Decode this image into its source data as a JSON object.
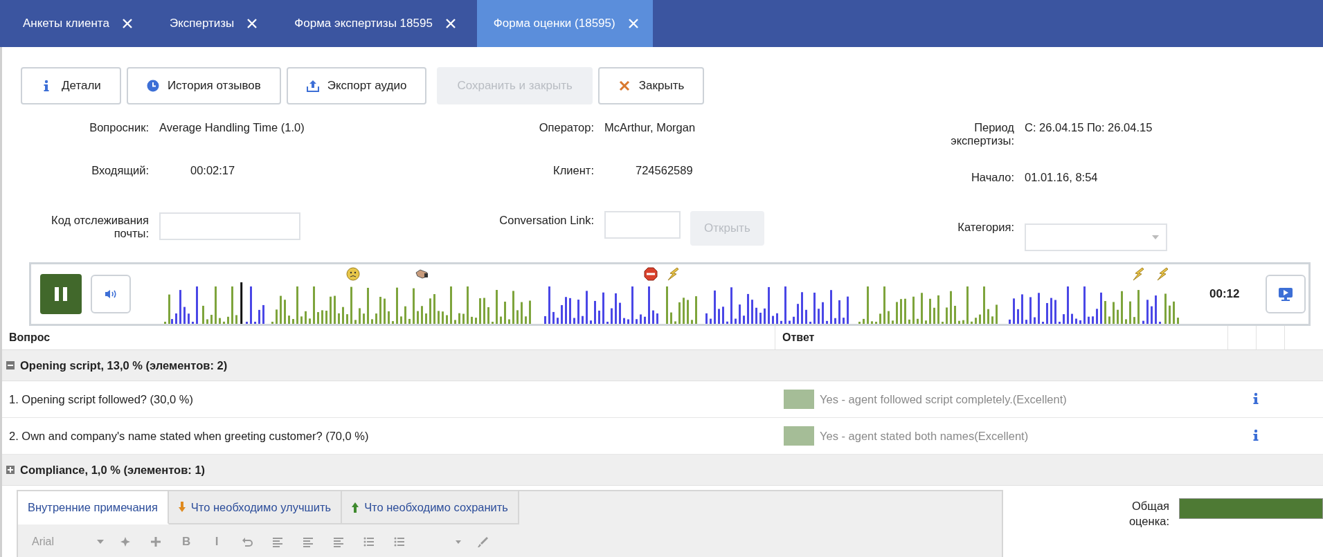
{
  "tabs": [
    {
      "label": "Анкеты клиента",
      "selected": false
    },
    {
      "label": "Экспертизы",
      "selected": false
    },
    {
      "label": "Форма экспертизы 18595",
      "selected": false
    },
    {
      "label": "Форма оценки (18595)",
      "selected": true
    }
  ],
  "toolbar": [
    {
      "kind": "info",
      "label": "Детали",
      "disabled": false
    },
    {
      "kind": "history",
      "label": "История отзывов",
      "disabled": false
    },
    {
      "kind": "export",
      "label": "Экспорт аудио",
      "disabled": false
    },
    {
      "kind": "plain",
      "label": "Сохранить и закрыть",
      "disabled": true
    },
    {
      "kind": "close",
      "label": "Закрыть",
      "disabled": false
    }
  ],
  "details": {
    "questionnaire_label": "Вопросник:",
    "questionnaire": "Average Handling Time (1.0)",
    "operator_label": "Оператор:",
    "operator": "McArthur, Morgan",
    "period_label": "Период экспертизы:",
    "period": "С: 26.04.15 По: 26.04.15",
    "incoming_label": "Входящий:",
    "incoming": "00:02:17",
    "client_label": "Клиент:",
    "client": "724562589",
    "start_label": "Начало:",
    "start": "01.01.16, 8:54",
    "tracking_label": "Код отслеживания почты:",
    "link_label": "Conversation Link:",
    "open_button": {
      "label": "Открыть",
      "disabled": true
    },
    "category_label": "Категория:"
  },
  "player": {
    "playing": true,
    "level": 0.076,
    "time": "00:12",
    "markers": [
      {
        "kind": "sad"
      },
      {
        "kind": "handshake"
      },
      {
        "kind": "stop"
      },
      {
        "kind": "bolt"
      },
      {
        "kind": "bolt"
      },
      {
        "kind": "bolt"
      }
    ]
  },
  "table": {
    "columns": [
      "Вопрос",
      "Ответ"
    ],
    "groups": [
      {
        "title": "Opening script, 13,0 % (элементов: 2)",
        "expanded": true,
        "items": [
          {
            "question": "1. Opening script followed? (30,0 %)",
            "answer": "Yes - agent followed script completely.(Excellent)",
            "color": "#a5bd97"
          },
          {
            "question": "2. Own and company's name stated when greeting customer? (70,0 %)",
            "answer": "Yes - agent stated both names(Excellent)",
            "color": "#a5bd97"
          }
        ]
      },
      {
        "title": "Compliance, 1,0 % (элементов: 1)",
        "expanded": false
      }
    ]
  },
  "notes": {
    "tabs": [
      {
        "kind": "plain",
        "label": "Внутренние примечания",
        "selected": true
      },
      {
        "kind": "down",
        "label": "Что необходимо улучшить",
        "selected": false
      },
      {
        "kind": "up",
        "label": "Что необходимо сохранить",
        "selected": false
      }
    ],
    "editor": {
      "disabled": true,
      "font": "Arial",
      "tools": [
        {
          "kind": "sparkle"
        },
        {
          "kind": "cross"
        },
        {
          "kind": "text",
          "label": "B"
        },
        {
          "kind": "text",
          "label": "I"
        },
        {
          "kind": "undo"
        },
        {
          "kind": "lines"
        },
        {
          "kind": "lines"
        },
        {
          "kind": "lines"
        },
        {
          "kind": "list"
        },
        {
          "kind": "list"
        },
        {
          "kind": "select"
        },
        {
          "kind": "brush"
        }
      ]
    }
  },
  "score": {
    "label": "Общая оценка:",
    "level": 1
  }
}
